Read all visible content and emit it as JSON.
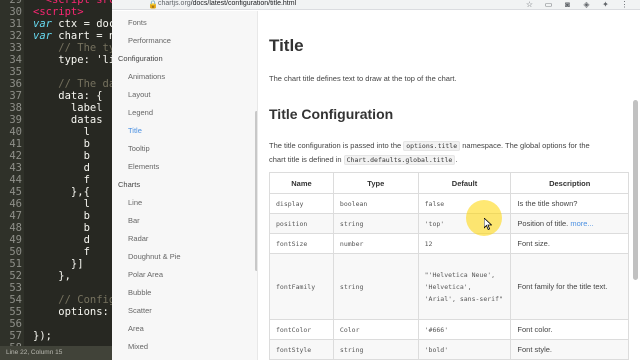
{
  "editor": {
    "lines": [
      {
        "n": "29",
        "parts": [
          {
            "t": "  <script src=",
            "c": "tag"
          }
        ]
      },
      {
        "n": "30",
        "parts": [
          {
            "t": "<script>",
            "c": "tag"
          }
        ]
      },
      {
        "n": "31",
        "parts": [
          {
            "t": "var",
            "c": "kw"
          },
          {
            "t": " ctx = docu",
            "c": ""
          }
        ]
      },
      {
        "n": "32",
        "parts": [
          {
            "t": "var",
            "c": "kw"
          },
          {
            "t": " chart = n",
            "c": ""
          }
        ]
      },
      {
        "n": "33",
        "parts": [
          {
            "t": "    // The ty",
            "c": "cm"
          }
        ]
      },
      {
        "n": "34",
        "parts": [
          {
            "t": "    type: 'li",
            "c": ""
          }
        ]
      },
      {
        "n": "35",
        "parts": [
          {
            "t": "",
            "c": ""
          }
        ]
      },
      {
        "n": "36",
        "parts": [
          {
            "t": "    // The da",
            "c": "cm"
          }
        ]
      },
      {
        "n": "37",
        "parts": [
          {
            "t": "    data: {",
            "c": ""
          }
        ]
      },
      {
        "n": "38",
        "parts": [
          {
            "t": "      label",
            "c": ""
          }
        ]
      },
      {
        "n": "39",
        "parts": [
          {
            "t": "      datas",
            "c": ""
          }
        ]
      },
      {
        "n": "40",
        "parts": [
          {
            "t": "        l",
            "c": ""
          }
        ]
      },
      {
        "n": "41",
        "parts": [
          {
            "t": "        b",
            "c": ""
          }
        ]
      },
      {
        "n": "42",
        "parts": [
          {
            "t": "        b",
            "c": ""
          }
        ]
      },
      {
        "n": "43",
        "parts": [
          {
            "t": "        d",
            "c": ""
          }
        ]
      },
      {
        "n": "44",
        "parts": [
          {
            "t": "        f",
            "c": ""
          }
        ]
      },
      {
        "n": "45",
        "parts": [
          {
            "t": "      },{",
            "c": ""
          }
        ]
      },
      {
        "n": "46",
        "parts": [
          {
            "t": "        l",
            "c": ""
          }
        ]
      },
      {
        "n": "47",
        "parts": [
          {
            "t": "        b",
            "c": ""
          }
        ]
      },
      {
        "n": "48",
        "parts": [
          {
            "t": "        b",
            "c": ""
          }
        ]
      },
      {
        "n": "49",
        "parts": [
          {
            "t": "        d",
            "c": ""
          }
        ]
      },
      {
        "n": "50",
        "parts": [
          {
            "t": "        f",
            "c": ""
          }
        ]
      },
      {
        "n": "51",
        "parts": [
          {
            "t": "      }]",
            "c": ""
          }
        ]
      },
      {
        "n": "52",
        "parts": [
          {
            "t": "    },",
            "c": ""
          }
        ]
      },
      {
        "n": "53",
        "parts": [
          {
            "t": "",
            "c": ""
          }
        ]
      },
      {
        "n": "54",
        "parts": [
          {
            "t": "    // Config",
            "c": "cm"
          }
        ]
      },
      {
        "n": "55",
        "parts": [
          {
            "t": "    options: ",
            "c": ""
          }
        ]
      },
      {
        "n": "56",
        "parts": [
          {
            "t": "",
            "c": ""
          }
        ]
      },
      {
        "n": "57",
        "parts": [
          {
            "t": "});",
            "c": ""
          }
        ]
      },
      {
        "n": "58",
        "parts": [
          {
            "t": "",
            "c": ""
          }
        ]
      }
    ],
    "status": "Line 22, Column 15"
  },
  "browser": {
    "url_host": "chartjs.org",
    "url_path": "/docs/latest/configuration/title.html"
  },
  "sidebar": {
    "entries": [
      {
        "label": "Fonts",
        "kind": "item"
      },
      {
        "label": "Performance",
        "kind": "item"
      },
      {
        "label": "Configuration",
        "kind": "section"
      },
      {
        "label": "Animations",
        "kind": "item"
      },
      {
        "label": "Layout",
        "kind": "item"
      },
      {
        "label": "Legend",
        "kind": "item"
      },
      {
        "label": "Title",
        "kind": "active"
      },
      {
        "label": "Tooltip",
        "kind": "item"
      },
      {
        "label": "Elements",
        "kind": "item"
      },
      {
        "label": "Charts",
        "kind": "section"
      },
      {
        "label": "Line",
        "kind": "item"
      },
      {
        "label": "Bar",
        "kind": "item"
      },
      {
        "label": "Radar",
        "kind": "item"
      },
      {
        "label": "Doughnut & Pie",
        "kind": "item"
      },
      {
        "label": "Polar Area",
        "kind": "item"
      },
      {
        "label": "Bubble",
        "kind": "item"
      },
      {
        "label": "Scatter",
        "kind": "item"
      },
      {
        "label": "Area",
        "kind": "item"
      },
      {
        "label": "Mixed",
        "kind": "item"
      }
    ]
  },
  "content": {
    "title": "Title",
    "intro": "The chart title defines text to draw at the top of the chart.",
    "config_heading": "Title Configuration",
    "config_text_1": "The title configuration is passed into the",
    "config_code_1": "options.title",
    "config_text_2": "namespace. The global options for the",
    "config_text_3": "chart title is defined in",
    "config_code_2": "Chart.defaults.global.title",
    "config_text_4": "."
  },
  "table": {
    "headers": [
      "Name",
      "Type",
      "Default",
      "Description"
    ],
    "rows": [
      {
        "name": "display",
        "type": "boolean",
        "default": "false",
        "desc": "Is the title shown?",
        "link": ""
      },
      {
        "name": "position",
        "type": "string",
        "default": "'top'",
        "desc": "Position of title.",
        "link": "more..."
      },
      {
        "name": "fontSize",
        "type": "number",
        "default": "12",
        "desc": "Font size.",
        "link": ""
      },
      {
        "name": "fontFamily",
        "type": "string",
        "default": "\"'Helvetica Neue', 'Helvetica', 'Arial', sans-serif\"",
        "desc": "Font family for the title text.",
        "link": ""
      },
      {
        "name": "fontColor",
        "type": "Color",
        "default": "'#666'",
        "desc": "Font color.",
        "link": ""
      },
      {
        "name": "fontStyle",
        "type": "string",
        "default": "'bold'",
        "desc": "Font style.",
        "link": ""
      }
    ]
  },
  "colors": {
    "editor_bg": "#272822",
    "link": "#4a90e2",
    "cursor_highlight": "#ffd600"
  }
}
